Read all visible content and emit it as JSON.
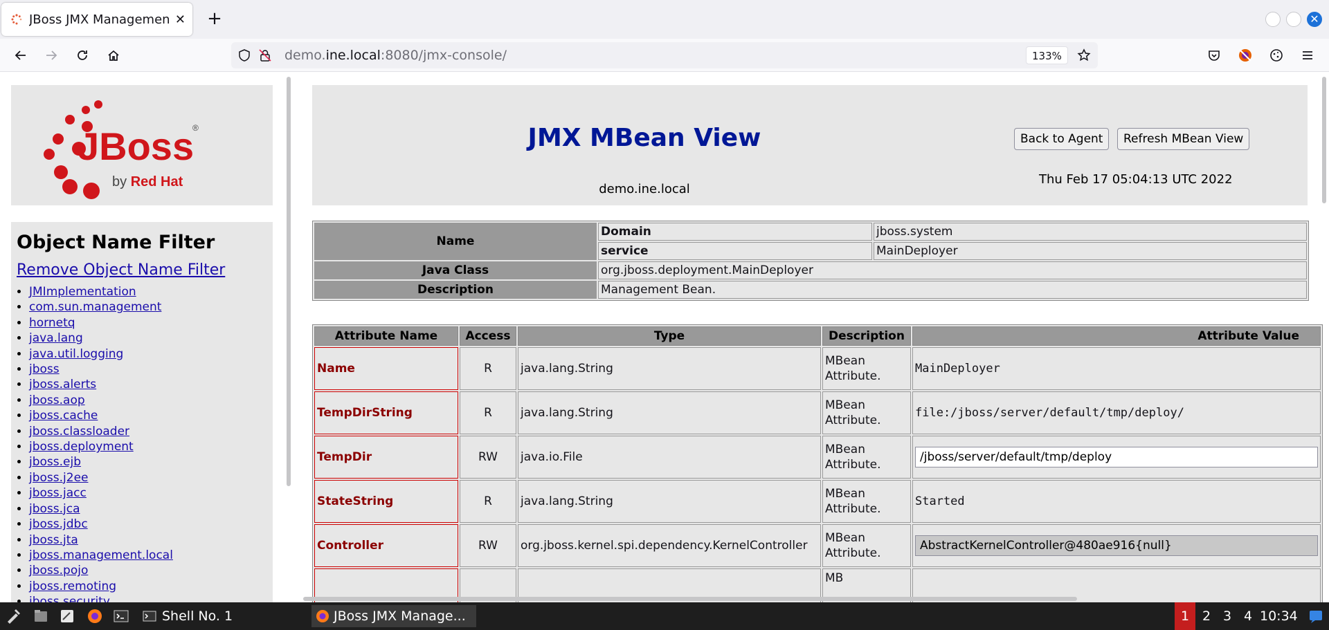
{
  "browser": {
    "tab_title": "JBoss JMX Managemen",
    "url_prefix": "demo.",
    "url_host": "ine.local",
    "url_suffix": ":8080/jmx-console/",
    "zoom": "133%"
  },
  "sidebar": {
    "logo_text": "JBoss",
    "logo_by": "by ",
    "logo_brand": "Red Hat",
    "filter_title": "Object Name Filter",
    "remove_filter": "Remove Object Name Filter",
    "domains": [
      "JMImplementation",
      "com.sun.management",
      "hornetq",
      "java.lang",
      "java.util.logging",
      "jboss",
      "jboss.alerts",
      "jboss.aop",
      "jboss.cache",
      "jboss.classloader",
      "jboss.deployment",
      "jboss.ejb",
      "jboss.j2ee",
      "jboss.jacc",
      "jboss.jca",
      "jboss.jdbc",
      "jboss.jta",
      "jboss.management.local",
      "jboss.pojo",
      "jboss.remoting",
      "jboss.security"
    ]
  },
  "header": {
    "title": "JMX MBean View",
    "host": "demo.ine.local",
    "back_button": "Back to Agent",
    "refresh_button": "Refresh MBean View",
    "date": "Thu Feb 17 05:04:13 UTC 2022"
  },
  "info": {
    "name_label": "Name",
    "domain_key": "Domain",
    "domain_value": "jboss.system",
    "service_key": "service",
    "service_value": "MainDeployer",
    "java_class_label": "Java Class",
    "java_class_value": "org.jboss.deployment.MainDeployer",
    "description_label": "Description",
    "description_value": "Management Bean."
  },
  "attributes": {
    "headers": [
      "Attribute Name",
      "Access",
      "Type",
      "Description",
      "Attribute Value"
    ],
    "rows": [
      {
        "name": "Name",
        "access": "R",
        "type": "java.lang.String",
        "desc": "MBean Attribute.",
        "value": "MainDeployer"
      },
      {
        "name": "TempDirString",
        "access": "R",
        "type": "java.lang.String",
        "desc": "MBean Attribute.",
        "value": "file:/jboss/server/default/tmp/deploy/"
      },
      {
        "name": "TempDir",
        "access": "RW",
        "type": "java.io.File",
        "desc": "MBean Attribute.",
        "value": "/jboss/server/default/tmp/deploy"
      },
      {
        "name": "StateString",
        "access": "R",
        "type": "java.lang.String",
        "desc": "MBean Attribute.",
        "value": "Started"
      },
      {
        "name": "Controller",
        "access": "RW",
        "type": "org.jboss.kernel.spi.dependency.KernelController",
        "desc": "MBean Attribute.",
        "value": "AbstractKernelController@480ae916{null}"
      },
      {
        "name": "",
        "access": "",
        "type": "",
        "desc": "MB",
        "value": ""
      }
    ]
  },
  "taskbar": {
    "shell_task": "Shell No. 1",
    "browser_task": "JBoss JMX Manage...",
    "workspaces": [
      "1",
      "2",
      "3",
      "4"
    ],
    "clock": "10:34"
  }
}
